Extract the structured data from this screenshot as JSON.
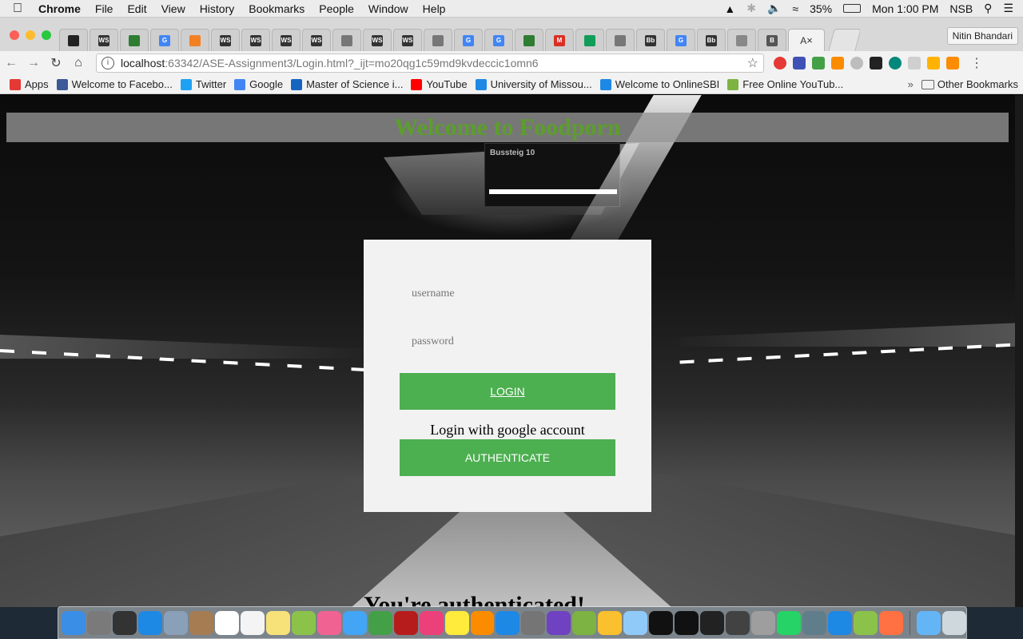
{
  "menubar": {
    "apple": "",
    "app_name": "Chrome",
    "menus": [
      "File",
      "Edit",
      "View",
      "History",
      "Bookmarks",
      "People",
      "Window",
      "Help"
    ],
    "battery": "35%",
    "clock": "Mon 1:00 PM",
    "user": "NSB"
  },
  "browser": {
    "profile_name": "Nitin Bhandari",
    "tabs": [
      {
        "icon": "github-icon",
        "label": "",
        "color": "#222222"
      },
      {
        "icon": "webstorm-icon",
        "label": "WS",
        "color": "#333333"
      },
      {
        "icon": "chrome-icon",
        "label": "",
        "color": "#2e7d32"
      },
      {
        "icon": "google-icon",
        "label": "G",
        "color": "#4285f4"
      },
      {
        "icon": "stackoverflow-icon",
        "label": "",
        "color": "#f48024"
      },
      {
        "icon": "webstorm-icon",
        "label": "WS",
        "color": "#333333"
      },
      {
        "icon": "webstorm-icon",
        "label": "WS",
        "color": "#333333"
      },
      {
        "icon": "webstorm-icon",
        "label": "WS",
        "color": "#333333"
      },
      {
        "icon": "webstorm-icon",
        "label": "WS",
        "color": "#333333"
      },
      {
        "icon": "document-icon",
        "label": "",
        "color": "#777777"
      },
      {
        "icon": "webstorm-icon",
        "label": "WS",
        "color": "#333333"
      },
      {
        "icon": "webstorm-icon",
        "label": "WS",
        "color": "#333333"
      },
      {
        "icon": "document-icon",
        "label": "",
        "color": "#777777"
      },
      {
        "icon": "google-icon",
        "label": "G",
        "color": "#4285f4"
      },
      {
        "icon": "google-icon",
        "label": "G",
        "color": "#4285f4"
      },
      {
        "icon": "diamond-icon",
        "label": "",
        "color": "#2e7d32"
      },
      {
        "icon": "gmail-icon",
        "label": "M",
        "color": "#d93025"
      },
      {
        "icon": "sheets-icon",
        "label": "",
        "color": "#0f9d58"
      },
      {
        "icon": "document-icon",
        "label": "",
        "color": "#777777"
      },
      {
        "icon": "blackboard-icon",
        "label": "Bb",
        "color": "#333333"
      },
      {
        "icon": "google-icon",
        "label": "G",
        "color": "#4285f4"
      },
      {
        "icon": "blackboard-icon",
        "label": "Bb",
        "color": "#333333"
      },
      {
        "icon": "citation-icon",
        "label": "",
        "color": "#888888"
      },
      {
        "icon": "audio-tab-icon",
        "label": "B",
        "color": "#555555"
      }
    ],
    "active_tab_label": "A",
    "url_host": "localhost",
    "url_path": ":63342/ASE-Assignment3/Login.html?_ijt=mo20qg1c59md9kvdeccic1omn6",
    "bookmarks": [
      {
        "icon": "apps-icon",
        "label": "Apps",
        "color": "#e53935"
      },
      {
        "icon": "facebook-icon",
        "label": "Welcome to Facebo...",
        "color": "#3b5998"
      },
      {
        "icon": "twitter-icon",
        "label": "Twitter",
        "color": "#1da1f2"
      },
      {
        "icon": "google-icon",
        "label": "Google",
        "color": "#4285f4"
      },
      {
        "icon": "university-icon",
        "label": "Master of Science i...",
        "color": "#1565c0"
      },
      {
        "icon": "youtube-icon",
        "label": "YouTube",
        "color": "#ff0000"
      },
      {
        "icon": "lightning-icon",
        "label": "University of Missou...",
        "color": "#1e88e5"
      },
      {
        "icon": "sbi-icon",
        "label": "Welcome to OnlineSBI",
        "color": "#1e88e5"
      },
      {
        "icon": "download-icon",
        "label": "Free Online YouTub...",
        "color": "#7cb342"
      }
    ],
    "other_bookmarks": "Other Bookmarks"
  },
  "page": {
    "header_title": "Welcome to Foodporn",
    "username_placeholder": "username",
    "password_placeholder": "password",
    "login_button": "LOGIN",
    "google_prompt": "Login with google account",
    "authenticate_button": "AUTHENTICATE",
    "auth_message": "You're authenticated!",
    "background_sign_title": "Bussteig 10",
    "colors": {
      "accent_green": "#4caf50",
      "title_green": "#5c9e2c",
      "panel": "#f2f2f2"
    }
  },
  "dock": {
    "apps": [
      {
        "icon": "finder-icon",
        "color": "#3a8ee6"
      },
      {
        "icon": "launchpad-icon",
        "color": "#7a7a7a"
      },
      {
        "icon": "mission-control-icon",
        "color": "#333333"
      },
      {
        "icon": "safari-icon",
        "color": "#1e88e5"
      },
      {
        "icon": "preview-icon",
        "color": "#8aa0b8"
      },
      {
        "icon": "contacts-icon",
        "color": "#a67c52"
      },
      {
        "icon": "calendar-icon",
        "color": "#ffffff"
      },
      {
        "icon": "reminders-icon",
        "color": "#f4f4f4"
      },
      {
        "icon": "notes-icon",
        "color": "#f7e27a"
      },
      {
        "icon": "maps-icon",
        "color": "#8bc34a"
      },
      {
        "icon": "photos-icon",
        "color": "#f06292"
      },
      {
        "icon": "messages-icon",
        "color": "#42a5f5"
      },
      {
        "icon": "facetime-icon",
        "color": "#43a047"
      },
      {
        "icon": "photo-booth-icon",
        "color": "#b71c1c"
      },
      {
        "icon": "itunes-icon",
        "color": "#ec407a"
      },
      {
        "icon": "stickies-icon",
        "color": "#ffeb3b"
      },
      {
        "icon": "ibooks-icon",
        "color": "#fb8c00"
      },
      {
        "icon": "app-store-icon",
        "color": "#1e88e5"
      },
      {
        "icon": "system-preferences-icon",
        "color": "#757575"
      },
      {
        "icon": "github-desktop-icon",
        "color": "#6f42c1"
      },
      {
        "icon": "android-studio-icon",
        "color": "#7cb342"
      },
      {
        "icon": "chrome-icon",
        "color": "#fbc02d"
      },
      {
        "icon": "virtualbox-icon",
        "color": "#90caf9"
      },
      {
        "icon": "intellij-icon",
        "color": "#111111"
      },
      {
        "icon": "webstorm-icon",
        "color": "#111111"
      },
      {
        "icon": "terminal-icon",
        "color": "#222222"
      },
      {
        "icon": "pathfinder-icon",
        "color": "#424242"
      },
      {
        "icon": "sword-icon",
        "color": "#9e9e9e"
      },
      {
        "icon": "whatsapp-icon",
        "color": "#25d366"
      },
      {
        "icon": "scanner-icon",
        "color": "#607d8b"
      },
      {
        "icon": "xcode-icon",
        "color": "#1e88e5"
      },
      {
        "icon": "battery-app-icon",
        "color": "#8bc34a"
      },
      {
        "icon": "pencil-app-icon",
        "color": "#ff7043"
      },
      {
        "icon": "downloads-folder-icon",
        "color": "#64b5f6"
      },
      {
        "icon": "trash-icon",
        "color": "#cfd8dc"
      }
    ]
  }
}
